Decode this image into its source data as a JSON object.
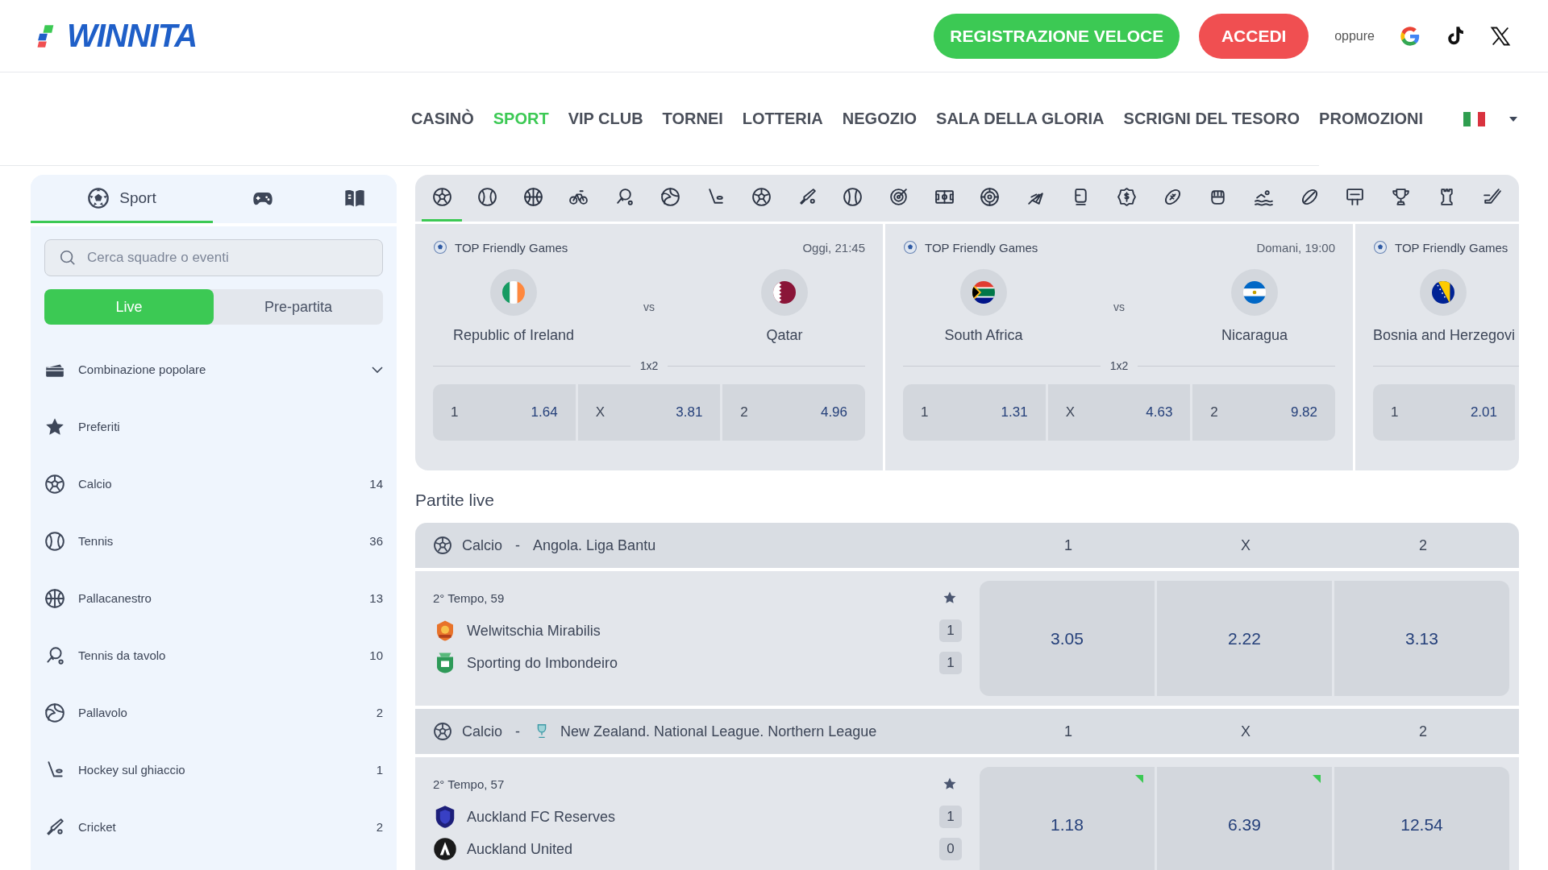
{
  "header": {
    "logo": "WINNITA",
    "register_button": "REGISTRAZIONE VELOCE",
    "login_button": "ACCEDI",
    "or_text": "oppure"
  },
  "nav": [
    {
      "label": "CASINÒ",
      "selected": false
    },
    {
      "label": "SPORT",
      "selected": true
    },
    {
      "label": "VIP CLUB",
      "selected": false
    },
    {
      "label": "TORNEI",
      "selected": false
    },
    {
      "label": "LOTTERIA",
      "selected": false
    },
    {
      "label": "NEGOZIO",
      "selected": false
    },
    {
      "label": "SALA DELLA GLORIA",
      "selected": false
    },
    {
      "label": "SCRIGNI DEL TESORO",
      "selected": false
    },
    {
      "label": "PROMOZIONI",
      "selected": false
    }
  ],
  "sidebar": {
    "tabs": [
      {
        "label": "Sport",
        "selected": true
      },
      {
        "selected": false
      },
      {
        "selected": false
      }
    ],
    "search": {
      "placeholder": "Cerca squadre o eventi"
    },
    "mode_toggle": [
      {
        "label": "Live",
        "selected": true
      },
      {
        "label": "Pre-partita",
        "selected": false
      }
    ],
    "popular_combo": {
      "label": "Combinazione popolare",
      "expanded": false
    },
    "items": [
      {
        "label": "Preferiti"
      },
      {
        "label": "Calcio",
        "count": "14"
      },
      {
        "label": "Tennis",
        "count": "36"
      },
      {
        "label": "Pallacanestro",
        "count": "13"
      },
      {
        "label": "Tennis da tavolo",
        "count": "10"
      },
      {
        "label": "Pallavolo",
        "count": "2"
      },
      {
        "label": "Hockey sul ghiaccio",
        "count": "1"
      },
      {
        "label": "Cricket",
        "count": "2"
      }
    ]
  },
  "sport_bar": [
    {
      "selected": true
    },
    {
      "selected": false
    },
    {
      "selected": false
    },
    {
      "selected": false
    },
    {
      "selected": false
    },
    {
      "selected": false
    },
    {
      "selected": false
    },
    {
      "selected": false
    },
    {
      "selected": false
    },
    {
      "selected": false
    },
    {
      "selected": false
    },
    {
      "selected": false
    },
    {
      "selected": false
    },
    {
      "selected": false
    },
    {
      "selected": false
    },
    {
      "selected": false
    },
    {
      "selected": false
    },
    {
      "selected": false
    },
    {
      "selected": false
    },
    {
      "selected": false
    },
    {
      "selected": false
    },
    {
      "selected": false
    },
    {
      "selected": false
    },
    {
      "selected": false
    }
  ],
  "featured": [
    {
      "league": "TOP Friendly Games",
      "time": "Oggi, 21:45",
      "home": "Republic of Ireland",
      "vs": "vs",
      "away": "Qatar",
      "market": "1x2",
      "odds": [
        {
          "label": "1",
          "value": "1.64"
        },
        {
          "label": "X",
          "value": "3.81"
        },
        {
          "label": "2",
          "value": "4.96"
        }
      ]
    },
    {
      "league": "TOP Friendly Games",
      "time": "Domani, 19:00",
      "home": "South Africa",
      "vs": "vs",
      "away": "Nicaragua",
      "market": "1x2",
      "odds": [
        {
          "label": "1",
          "value": "1.31"
        },
        {
          "label": "X",
          "value": "4.63"
        },
        {
          "label": "2",
          "value": "9.82"
        }
      ]
    },
    {
      "league": "TOP Friendly Games",
      "home": "Bosnia and Herzegovi",
      "odds": [
        {
          "label": "1",
          "value": "2.01"
        }
      ]
    }
  ],
  "live": {
    "title": "Partite live",
    "groups": [
      {
        "sport": "Calcio",
        "separator": "-",
        "league": "Angola. Liga Bantu",
        "league_logo": false,
        "columns": [
          "1",
          "X",
          "2"
        ],
        "match": {
          "period": "2° Tempo, 59",
          "teams": [
            {
              "name": "Welwitschia Mirabilis",
              "score": "1"
            },
            {
              "name": "Sporting do Imbondeiro",
              "score": "1"
            }
          ],
          "odds": [
            {
              "value": "3.05",
              "rising": false
            },
            {
              "value": "2.22",
              "rising": false
            },
            {
              "value": "3.13",
              "rising": false
            }
          ]
        }
      },
      {
        "sport": "Calcio",
        "separator": "-",
        "league": "New Zealand. National League. Northern League",
        "league_logo": true,
        "columns": [
          "1",
          "X",
          "2"
        ],
        "match": {
          "period": "2° Tempo, 57",
          "teams": [
            {
              "name": "Auckland FC Reserves",
              "score": "1"
            },
            {
              "name": "Auckland United",
              "score": "0"
            }
          ],
          "odds": [
            {
              "value": "1.18",
              "rising": true
            },
            {
              "value": "6.39",
              "rising": true
            },
            {
              "value": "12.54",
              "rising": false
            }
          ]
        }
      }
    ]
  }
}
